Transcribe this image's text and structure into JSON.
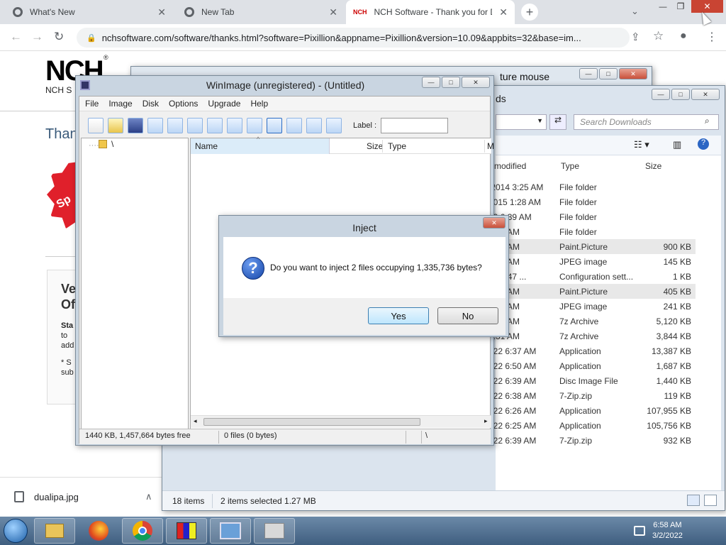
{
  "browser": {
    "tabs": [
      {
        "title": "What's New",
        "close": "✕"
      },
      {
        "title": "New Tab",
        "close": "✕"
      },
      {
        "title": "NCH Software - Thank you for D",
        "close": "✕"
      }
    ],
    "new_tab": "+",
    "url": "nchsoftware.com/software/thanks.html?software=Pixillion&appname=Pixillion&version=10.09&appbits=32&base=im...",
    "nav": {
      "back": "←",
      "forward": "→",
      "reload": "↻"
    },
    "toolbar": {
      "lock": "🔒",
      "share": "⇪",
      "star": "☆",
      "profile": "●",
      "menu": "⋮"
    },
    "window_controls": {
      "min": "—",
      "max": "❐",
      "close": "✕"
    }
  },
  "page": {
    "logo": "NCH",
    "logo_sub": "NCH S",
    "reg": "®",
    "thanks": "Than",
    "badge": "Sp",
    "card_title": "Ve",
    "card_title2": "Of",
    "card_text": "Sta",
    "card_text2": "to",
    "card_text3": "add",
    "card_text4": "* S",
    "card_text5": "sub"
  },
  "download": {
    "file": "dualipa.jpg",
    "chevron": "∧"
  },
  "capture_window": {
    "title": "ture mouse"
  },
  "explorer": {
    "title": "ds",
    "search_placeholder": "Search Downloads",
    "columns": {
      "modified": "modified",
      "type": "Type",
      "size": "Size"
    },
    "rows": [
      {
        "date": "/2014 3:25 AM",
        "type": "File folder",
        "size": ""
      },
      {
        "date": "2015 1:28 AM",
        "type": "File folder",
        "size": ""
      },
      {
        "date": "22 6:39 AM",
        "type": "File folder",
        "size": ""
      },
      {
        "date": "6:39 AM",
        "type": "File folder",
        "size": ""
      },
      {
        "date": "6:55 AM",
        "type": "Paint.Picture",
        "size": "900 KB",
        "sel": true
      },
      {
        "date": "6:55 AM",
        "type": "JPEG image",
        "size": "145 KB"
      },
      {
        "date": "1 10:47 ...",
        "type": "Configuration sett...",
        "size": "1 KB"
      },
      {
        "date": "5:58 AM",
        "type": "Paint.Picture",
        "size": "405 KB",
        "sel": true
      },
      {
        "date": "6:56 AM",
        "type": "JPEG image",
        "size": "241 KB"
      },
      {
        "date": "6:30 AM",
        "type": "7z Archive",
        "size": "5,120 KB"
      },
      {
        "date": "6:31 AM",
        "type": "7z Archive",
        "size": "3,844 KB"
      },
      {
        "date": "022 6:37 AM",
        "type": "Application",
        "size": "13,387 KB"
      },
      {
        "date": "022 6:50 AM",
        "type": "Application",
        "size": "1,687 KB"
      },
      {
        "date": "022 6:39 AM",
        "type": "Disc Image File",
        "size": "1,440 KB"
      },
      {
        "date": "022 6:38 AM",
        "type": "7-Zip.zip",
        "size": "119 KB"
      },
      {
        "date": "022 6:26 AM",
        "type": "Application",
        "size": "107,955 KB"
      },
      {
        "date": "022 6:25 AM",
        "type": "Application",
        "size": "105,756 KB"
      },
      {
        "date": "022 6:39 AM",
        "type": "7-Zip.zip",
        "size": "932 KB"
      }
    ],
    "status": {
      "items": "18 items",
      "selected": "2 items selected  1.27 MB"
    }
  },
  "winimage": {
    "title": "WinImage (unregistered) - (Untitled)",
    "menu": [
      "File",
      "Image",
      "Disk",
      "Options",
      "Upgrade",
      "Help"
    ],
    "label_text": "Label :",
    "tree_root": "\\",
    "columns": {
      "name": "Name",
      "size": "Size",
      "type": "Type",
      "m": "M"
    },
    "status": {
      "free": "1440 KB, 1,457,664 bytes free",
      "files": "0 files (0 bytes)",
      "path": "\\"
    }
  },
  "dialog": {
    "title": "Inject",
    "message": "Do you want to inject 2 files occupying 1,335,736 bytes?",
    "yes": "Yes",
    "no": "No",
    "icon": "?"
  },
  "taskbar": {
    "time": "6:58 AM",
    "date": "3/2/2022"
  }
}
